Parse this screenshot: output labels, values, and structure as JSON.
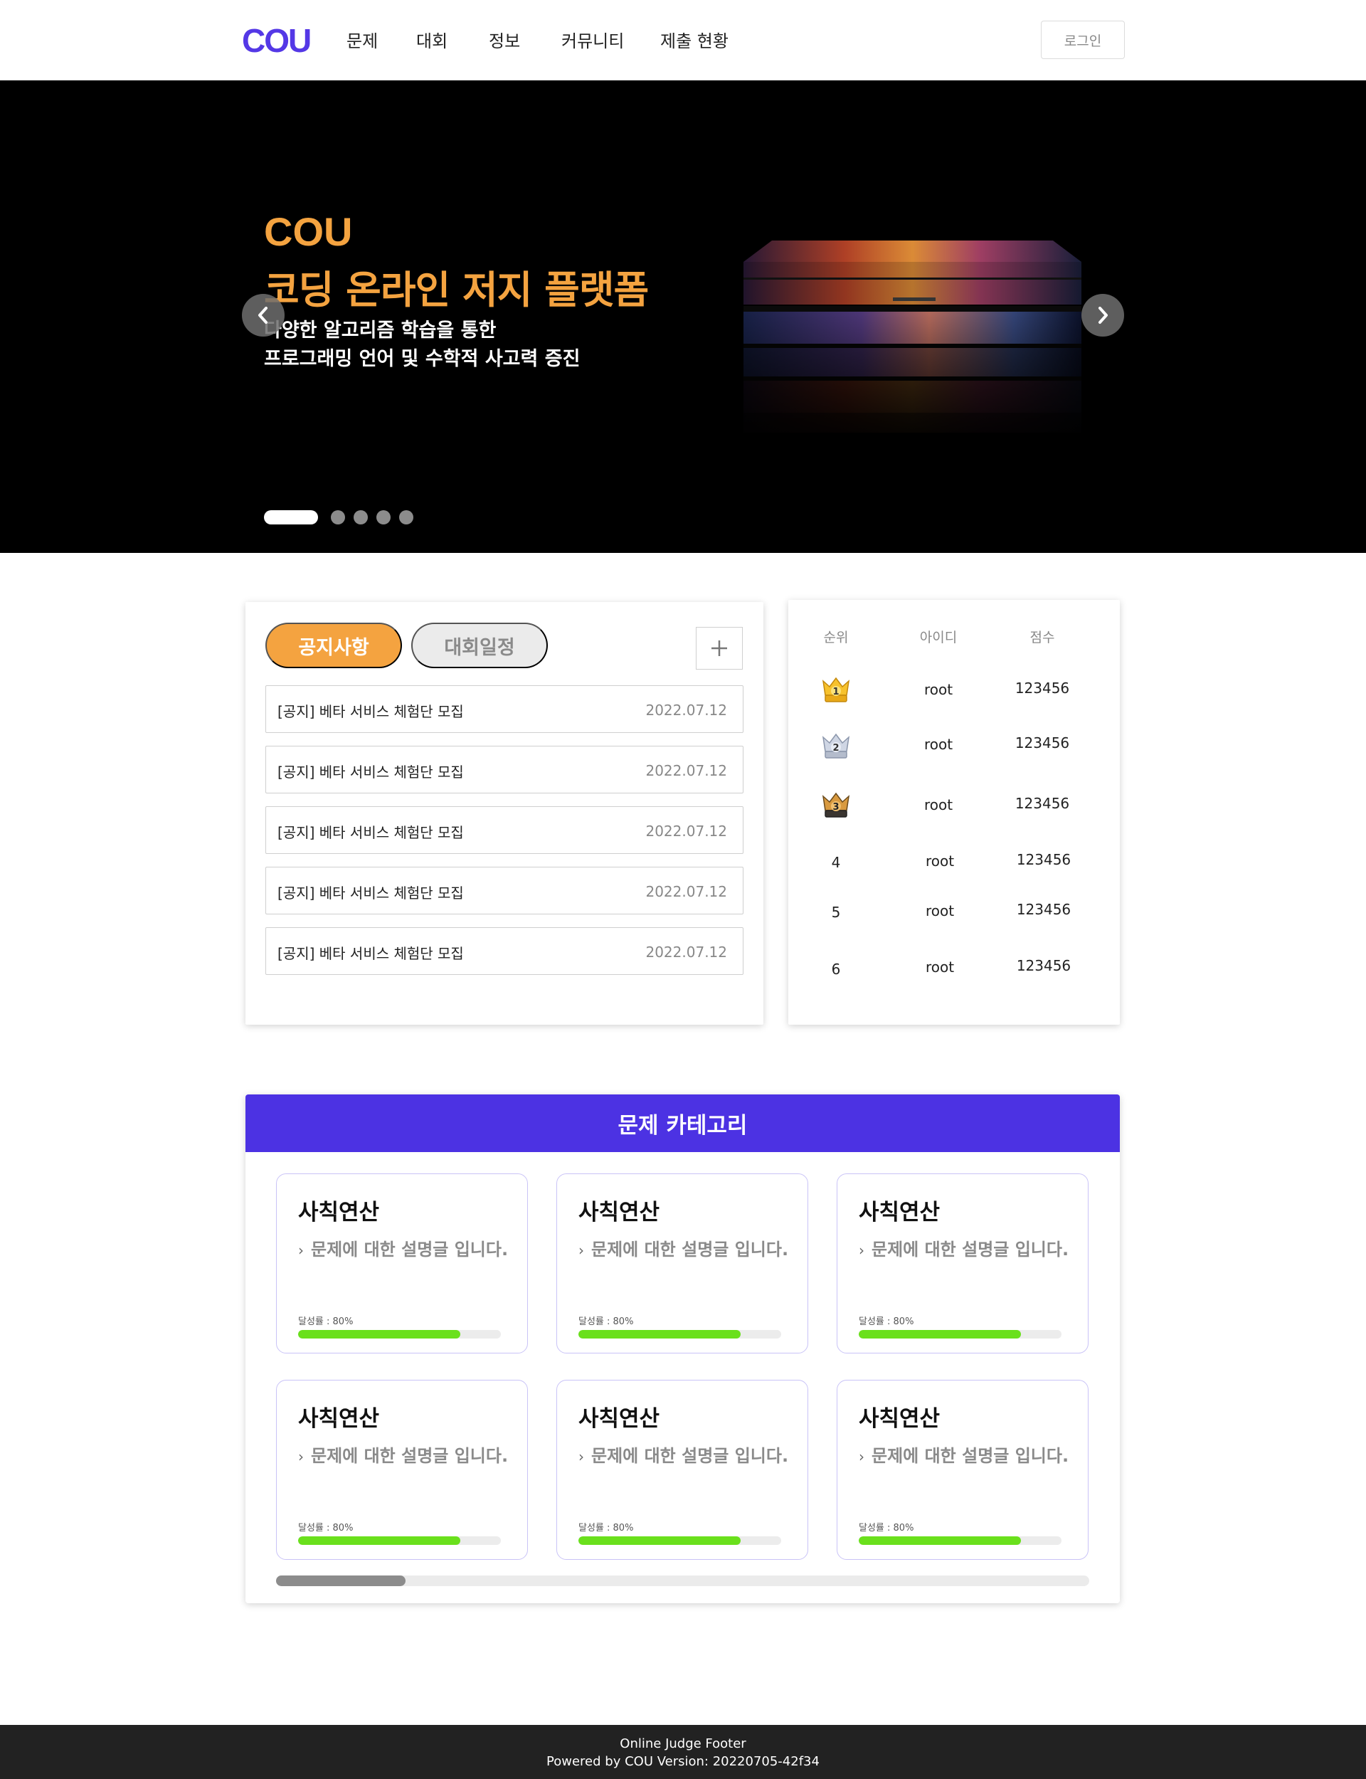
{
  "nav": {
    "logo": "COU",
    "items": [
      "문제",
      "대회",
      "정보",
      "커뮤니티",
      "제출 현황"
    ],
    "login_label": "로그인"
  },
  "hero": {
    "brand": "COU",
    "title": "코딩 온라인 저지 플랫폼",
    "subtitle_line1": "다양한 알고리즘 학습을 통한",
    "subtitle_line2": "프로그래밍 언어 및 수학적 사고력 증진",
    "slide_count": 5,
    "active_slide": 1
  },
  "notice": {
    "tabs": [
      "공지사항",
      "대회일정"
    ],
    "active_tab": "공지사항",
    "add_label": "+",
    "rows": [
      {
        "title": "[공지] 베타 서비스 체험단 모집",
        "date": "2022.07.12"
      },
      {
        "title": "[공지] 베타 서비스 체험단 모집",
        "date": "2022.07.12"
      },
      {
        "title": "[공지] 베타 서비스 체험단 모집",
        "date": "2022.07.12"
      },
      {
        "title": "[공지] 베타 서비스 체험단 모집",
        "date": "2022.07.12"
      },
      {
        "title": "[공지] 베타 서비스 체험단 모집",
        "date": "2022.07.12"
      }
    ]
  },
  "ranking": {
    "headers": [
      "순위",
      "아이디",
      "점수"
    ],
    "rows": [
      {
        "rank": "1",
        "medal": "gold-medal-icon",
        "id": "root",
        "score": "123456"
      },
      {
        "rank": "2",
        "medal": "silver-medal-icon",
        "id": "root",
        "score": "123456"
      },
      {
        "rank": "3",
        "medal": "bronze-medal-icon",
        "id": "root",
        "score": "123456"
      },
      {
        "rank": "4",
        "medal": "",
        "id": "root",
        "score": "123456"
      },
      {
        "rank": "5",
        "medal": "",
        "id": "root",
        "score": "123456"
      },
      {
        "rank": "6",
        "medal": "",
        "id": "root",
        "score": "123456"
      }
    ]
  },
  "category": {
    "header": "문제 카테고리",
    "items": [
      {
        "title": "사칙연산",
        "desc": "문제에 대한 설명글 입니다.",
        "rate_label": "달성률 : 80%",
        "progress": 0.8
      },
      {
        "title": "사칙연산",
        "desc": "문제에 대한 설명글 입니다.",
        "rate_label": "달성률 : 80%",
        "progress": 0.8
      },
      {
        "title": "사칙연산",
        "desc": "문제에 대한 설명글 입니다.",
        "rate_label": "달성률 : 80%",
        "progress": 0.8
      },
      {
        "title": "사칙연산",
        "desc": "문제에 대한 설명글 입니다.",
        "rate_label": "달성률 : 80%",
        "progress": 0.8
      },
      {
        "title": "사칙연산",
        "desc": "문제에 대한 설명글 입니다.",
        "rate_label": "달성률 : 80%",
        "progress": 0.8
      },
      {
        "title": "사칙연산",
        "desc": "문제에 대한 설명글 입니다.",
        "rate_label": "달성률 : 80%",
        "progress": 0.8
      }
    ]
  },
  "footer": {
    "line1": "Online Judge Footer",
    "line2": "Powered by COU   Version: 20220705-42f34"
  },
  "colors": {
    "brand_purple": "#5438e6",
    "category_header": "#4c32e3",
    "accent_orange": "#f4a340",
    "progress_green": "#6ae01c",
    "footer_bg": "#222222"
  }
}
